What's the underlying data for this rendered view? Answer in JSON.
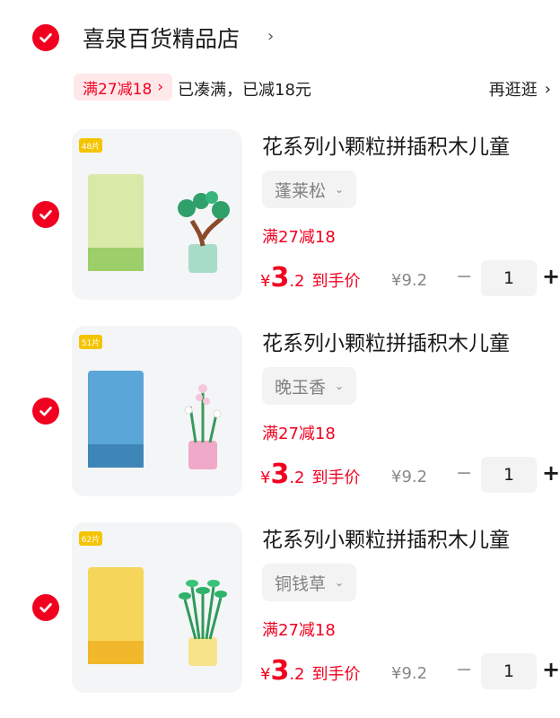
{
  "store": {
    "name": "喜泉百货精品店",
    "chevron": "›"
  },
  "promo": {
    "tag": "满27减18",
    "tag_arrow": "›",
    "status": "已凑满，已减18元",
    "browse_label": "再逛逛",
    "browse_arrow": "›"
  },
  "items": [
    {
      "title": "花系列小颗粒拼插积木儿童",
      "variant": "蓬莱松",
      "discount": "满27减18",
      "price": {
        "currency": "¥",
        "integer": "3",
        "decimal": ".2",
        "suffix": "到手价"
      },
      "original_price": "¥9.2",
      "quantity": "1",
      "badge": "48片"
    },
    {
      "title": "花系列小颗粒拼插积木儿童",
      "variant": "晚玉香",
      "discount": "满27减18",
      "price": {
        "currency": "¥",
        "integer": "3",
        "decimal": ".2",
        "suffix": "到手价"
      },
      "original_price": "¥9.2",
      "quantity": "1",
      "badge": "51片"
    },
    {
      "title": "花系列小颗粒拼插积木儿童",
      "variant": "铜钱草",
      "discount": "满27减18",
      "price": {
        "currency": "¥",
        "integer": "3",
        "decimal": ".2",
        "suffix": "到手价"
      },
      "original_price": "¥9.2",
      "quantity": "1",
      "badge": "62片"
    }
  ],
  "controls": {
    "minus": "−",
    "plus": "+",
    "variant_chevron": "⌄"
  },
  "colors": {
    "accent": "#f1001f",
    "tag_bg": "#ffe8ea"
  }
}
